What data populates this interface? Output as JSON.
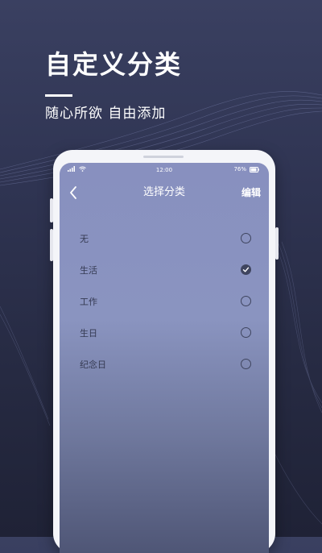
{
  "promo": {
    "title": "自定义分类",
    "subtitle": "随心所欲  自由添加"
  },
  "status_bar": {
    "time": "12:00",
    "battery": "76%"
  },
  "nav": {
    "back_icon": "chevron-left-icon",
    "title": "选择分类",
    "edit_label": "编辑"
  },
  "categories": [
    {
      "label": "无",
      "selected": false
    },
    {
      "label": "生活",
      "selected": true
    },
    {
      "label": "工作",
      "selected": false
    },
    {
      "label": "生日",
      "selected": false
    },
    {
      "label": "纪念日",
      "selected": false
    }
  ],
  "colors": {
    "background": "#2f3452",
    "screen_top": "#8890bf",
    "screen_bottom": "#4f5676",
    "accent_dark": "#3f455f",
    "text_white": "#ffffff"
  }
}
